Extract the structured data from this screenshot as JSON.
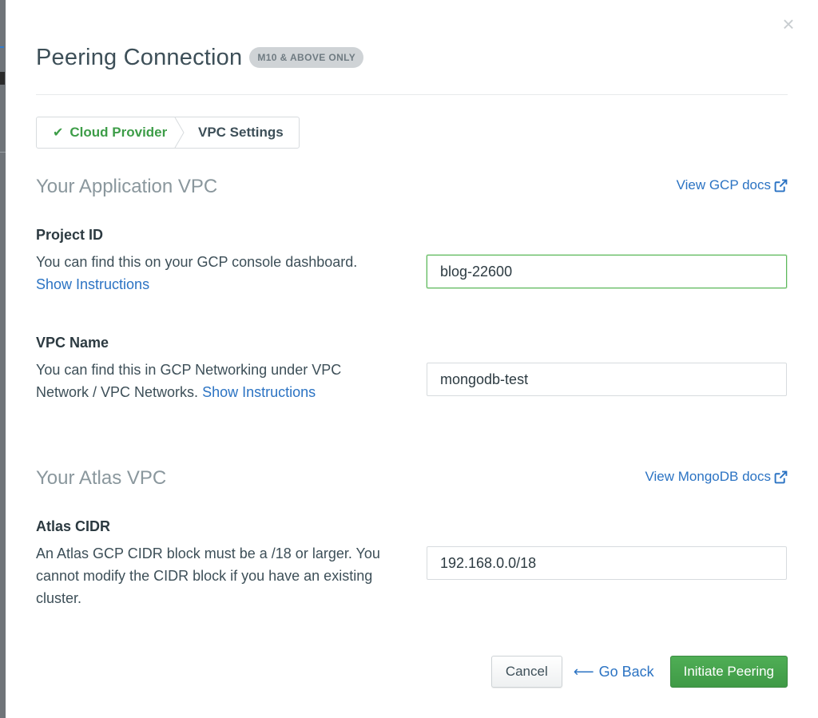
{
  "modal": {
    "title": "Peering Connection",
    "badge": "M10 & ABOVE ONLY",
    "close_icon": "close-icon"
  },
  "wizard": {
    "steps": [
      {
        "label": "Cloud Provider",
        "state": "complete",
        "icon": "check-icon"
      },
      {
        "label": "VPC Settings",
        "state": "active"
      }
    ]
  },
  "app_vpc": {
    "title": "Your Application VPC",
    "docs_link": "View GCP docs",
    "docs_icon": "external-link-icon",
    "project_id": {
      "label": "Project ID",
      "description": "You can find this on your GCP console dashboard.",
      "link": "Show Instructions",
      "value": "blog-22600"
    },
    "vpc_name": {
      "label": "VPC Name",
      "description": "You can find this in GCP Networking under VPC Network / VPC Networks.",
      "link": "Show Instructions",
      "value": "mongodb-test"
    }
  },
  "atlas_vpc": {
    "title": "Your Atlas VPC",
    "docs_link": "View MongoDB docs",
    "docs_icon": "external-link-icon",
    "cidr": {
      "label": "Atlas CIDR",
      "description": "An Atlas GCP CIDR block must be a /18 or larger. You cannot modify the CIDR block if you have an existing cluster.",
      "value": "192.168.0.0/18"
    }
  },
  "footer": {
    "cancel_label": "Cancel",
    "go_back_label": "Go Back",
    "submit_label": "Initiate Peering"
  },
  "colors": {
    "link": "#2b73c3",
    "success": "#3d9d48",
    "primary_button": "#47a34e",
    "section_title": "#8a979d"
  }
}
